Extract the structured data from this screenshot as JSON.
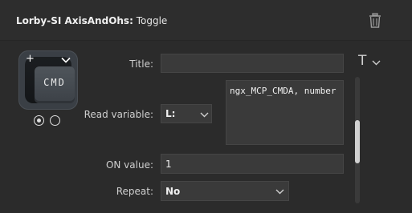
{
  "header": {
    "plugin_name": "Lorby-SI AxisAndOhs:",
    "action_type": "Toggle"
  },
  "icons": {
    "delete": "trash-icon",
    "font": "text-format-icon",
    "dropdown": "chevron-down-icon"
  },
  "key_preview": {
    "label": "CMD",
    "add_symbol": "+",
    "state_count": 2,
    "selected_state": 0
  },
  "form": {
    "title_label": "Title:",
    "title_value": "",
    "title_format_symbol": "T",
    "read_variable_label": "Read variable:",
    "read_variable_type": "L:",
    "read_variable_value": "ngx_MCP_CMDA, number",
    "on_value_label": "ON value:",
    "on_value": "1",
    "repeat_label": "Repeat:",
    "repeat_value": "No"
  }
}
